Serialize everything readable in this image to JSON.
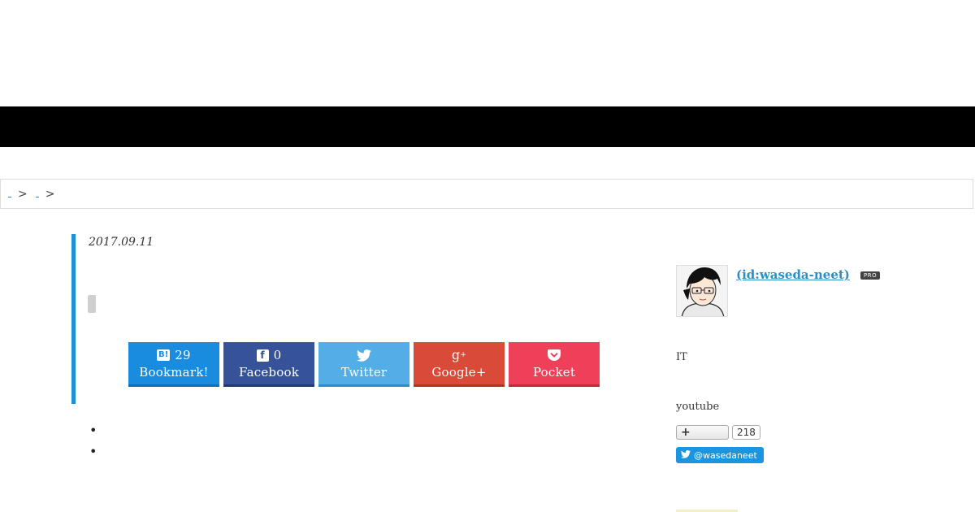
{
  "breadcrumb": {
    "links": [
      "",
      ""
    ],
    "separator": ">"
  },
  "article": {
    "date": "2017.09.11",
    "share_buttons": [
      {
        "name": "hatena",
        "count": "29",
        "label": "Bookmark!",
        "icon": "hatena-b-icon",
        "color": "#1a8ce0"
      },
      {
        "name": "facebook",
        "count": "0",
        "label": "Facebook",
        "icon": "facebook-icon",
        "color": "#365399"
      },
      {
        "name": "twitter",
        "label": "Twitter",
        "icon": "twitter-bird-icon",
        "color": "#53aee8"
      },
      {
        "name": "google",
        "label": "Google+",
        "icon": "google-plus-icon",
        "color": "#d94a38"
      },
      {
        "name": "pocket",
        "label": "Pocket",
        "icon": "pocket-icon",
        "color": "#ee4058"
      }
    ]
  },
  "sidebar": {
    "author_link": " (id:waseda-neet)",
    "badge": "PRO",
    "profile_text": "IT",
    "youtube_text": "youtube",
    "subscribe_count": "218",
    "follow_label": "@wasedaneet"
  },
  "colors": {
    "accent": "#1e90d8",
    "link": "#2a8fc6",
    "topbar": "#000000"
  }
}
